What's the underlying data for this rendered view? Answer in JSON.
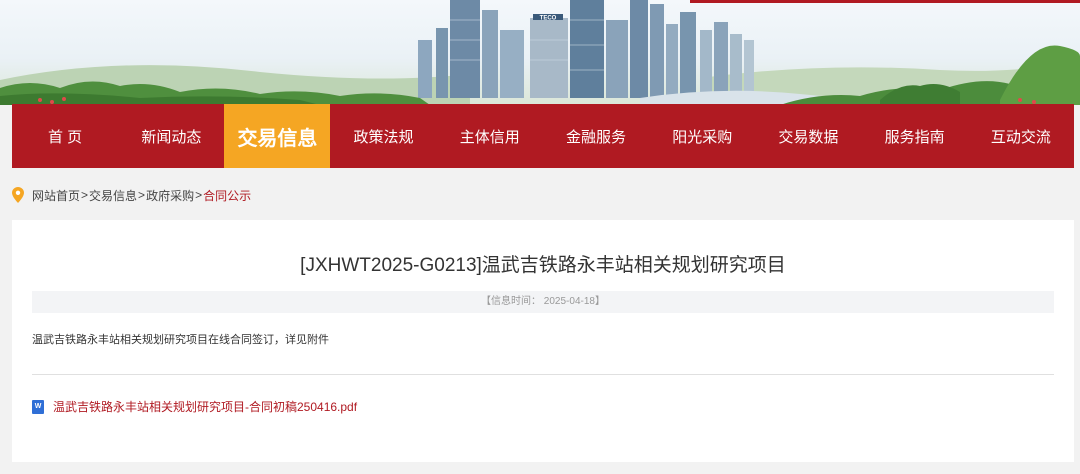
{
  "nav": {
    "items": [
      {
        "label": "首 页"
      },
      {
        "label": "新闻动态"
      },
      {
        "label": "交易信息",
        "active": true
      },
      {
        "label": "政策法规"
      },
      {
        "label": "主体信用"
      },
      {
        "label": "金融服务"
      },
      {
        "label": "阳光采购"
      },
      {
        "label": "交易数据"
      },
      {
        "label": "服务指南"
      },
      {
        "label": "互动交流"
      }
    ]
  },
  "breadcrumb": {
    "home": "网站首页",
    "level1": "交易信息",
    "level2": "政府采购",
    "current": "合同公示",
    "separator": ">"
  },
  "article": {
    "title": "[JXHWT2025-G0213]温武吉铁路永丰站相关规划研究项目",
    "meta": "【信息时间： 2025-04-18】",
    "body": "温武吉铁路永丰站相关规划研究项目在线合同签订，详见附件",
    "attachment": {
      "name": "温武吉铁路永丰站相关规划研究项目-合同初稿250416.pdf",
      "icon": "word-file-icon",
      "icon_letter": "W"
    }
  },
  "banner": {
    "building_sign": "TECO"
  },
  "colors": {
    "brand_red": "#b01a22",
    "active_orange": "#f5a623"
  }
}
